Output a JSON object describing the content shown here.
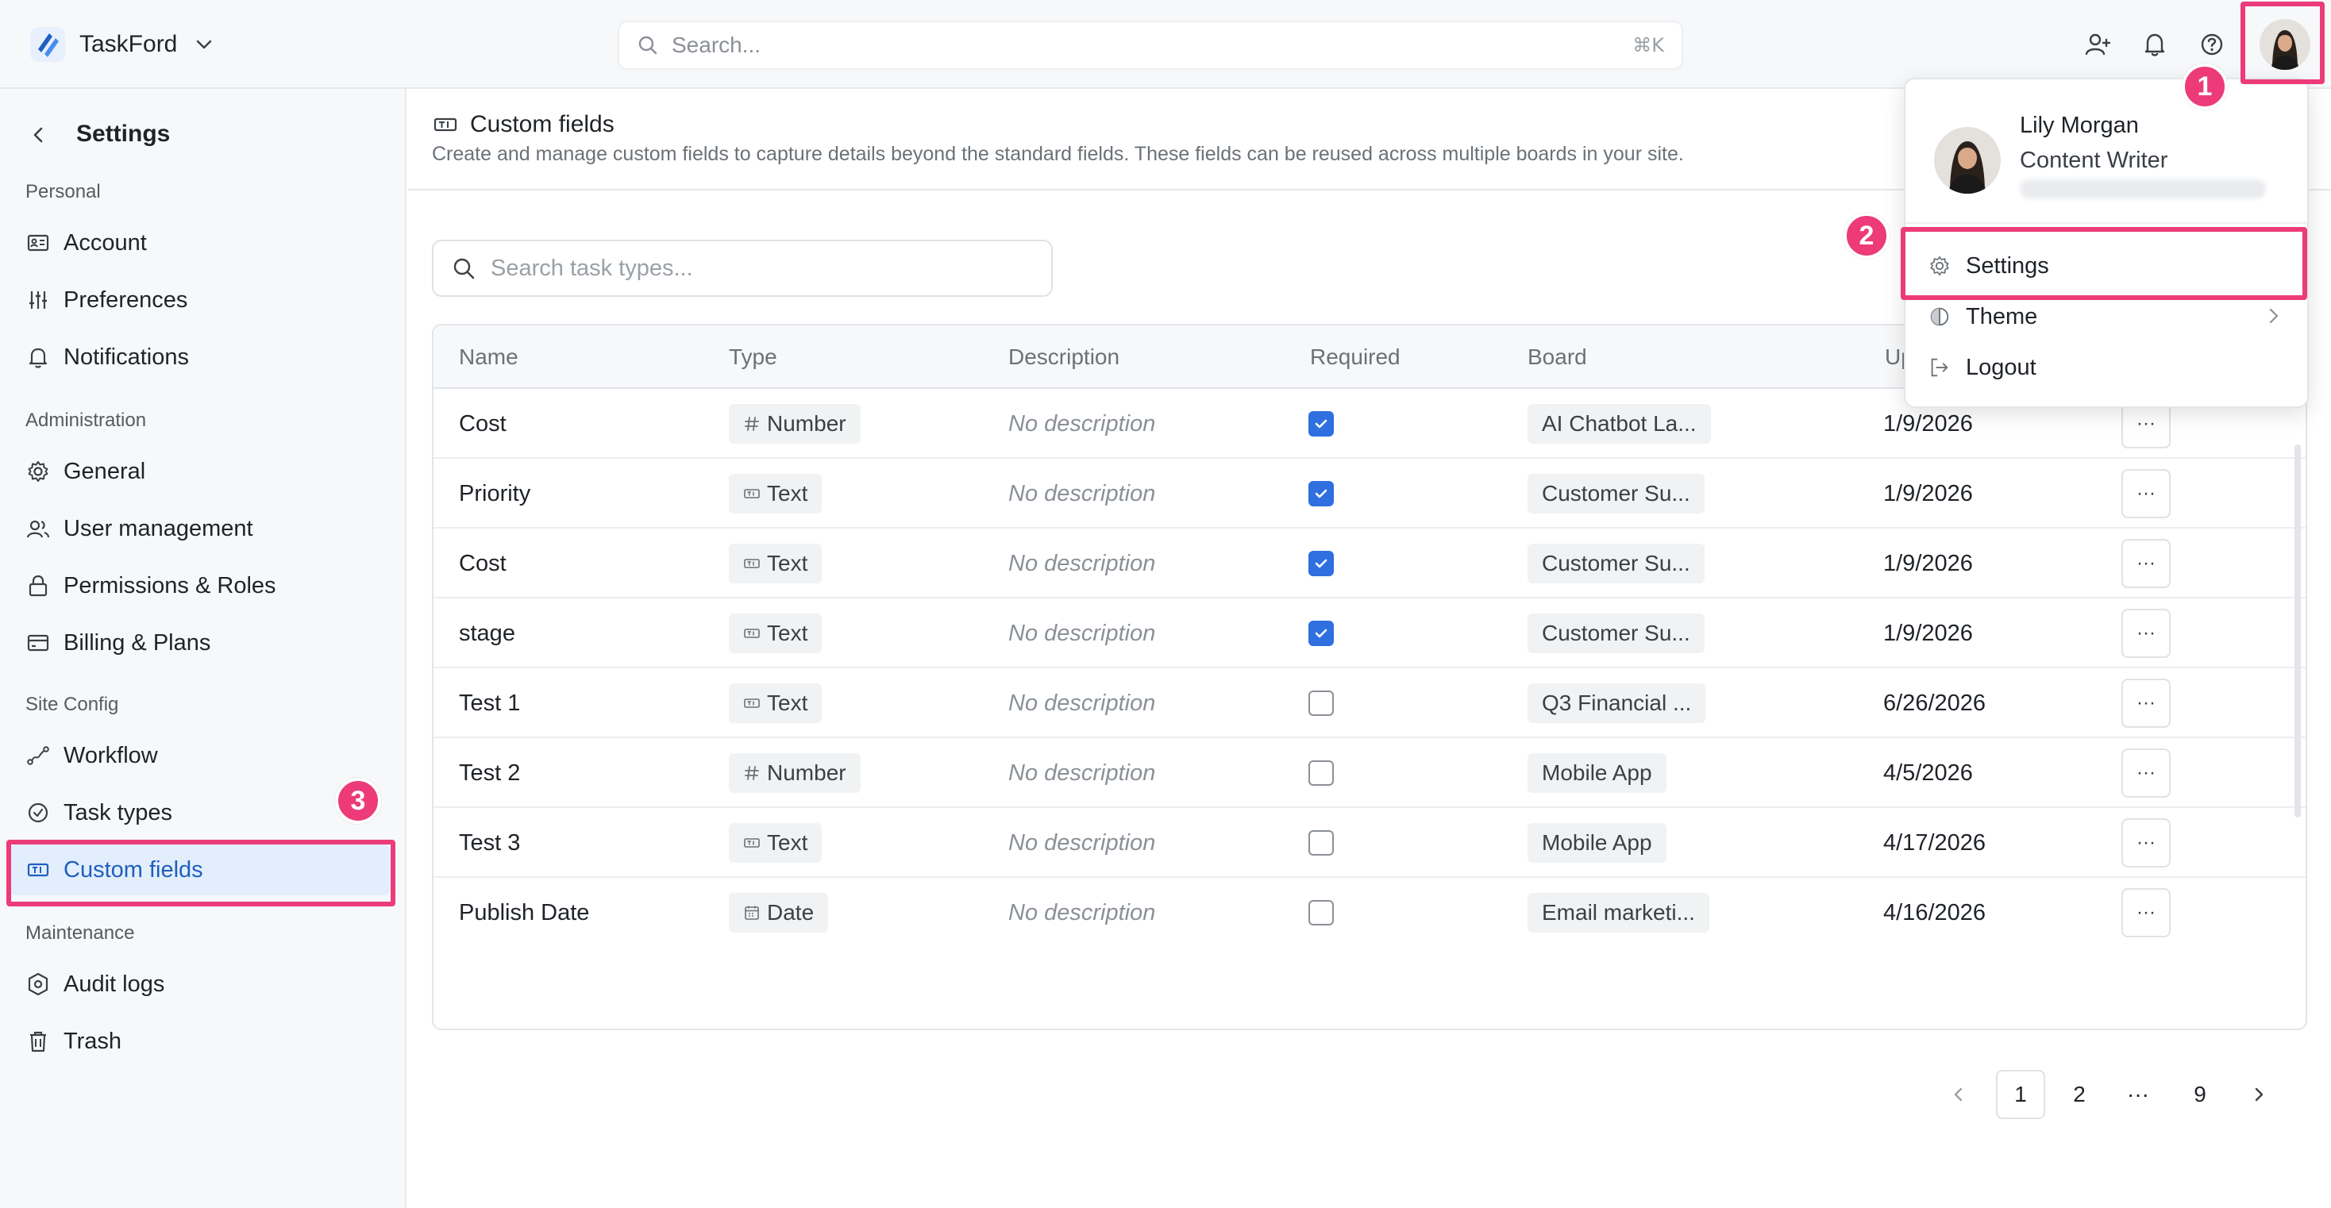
{
  "app": {
    "name": "TaskFord"
  },
  "search": {
    "placeholder": "Search...",
    "shortcut": "⌘K"
  },
  "sidebar": {
    "title": "Settings",
    "sections": [
      {
        "label": "Personal",
        "items": [
          {
            "label": "Account"
          },
          {
            "label": "Preferences"
          },
          {
            "label": "Notifications"
          }
        ]
      },
      {
        "label": "Administration",
        "items": [
          {
            "label": "General"
          },
          {
            "label": "User management"
          },
          {
            "label": "Permissions & Roles"
          },
          {
            "label": "Billing & Plans"
          }
        ]
      },
      {
        "label": "Site Config",
        "items": [
          {
            "label": "Workflow"
          },
          {
            "label": "Task types"
          },
          {
            "label": "Custom fields"
          }
        ]
      },
      {
        "label": "Maintenance",
        "items": [
          {
            "label": "Audit logs"
          },
          {
            "label": "Trash"
          }
        ]
      }
    ]
  },
  "page": {
    "title": "Custom fields",
    "description": "Create and manage custom fields to capture details beyond the standard fields. These fields can be reused across multiple boards in your site.",
    "search_placeholder": "Search task types..."
  },
  "table": {
    "columns": [
      "Name",
      "Type",
      "Description",
      "Required",
      "Board",
      "Up"
    ],
    "rows": [
      {
        "name": "Cost",
        "type": "Number",
        "type_icon": "hash-icon",
        "description": "No description",
        "required": true,
        "board": "AI Chatbot La...",
        "updated": "1/9/2026"
      },
      {
        "name": "Priority",
        "type": "Text",
        "type_icon": "text-field-icon",
        "description": "No description",
        "required": true,
        "board": "Customer Su...",
        "updated": "1/9/2026"
      },
      {
        "name": "Cost",
        "type": "Text",
        "type_icon": "text-field-icon",
        "description": "No description",
        "required": true,
        "board": "Customer Su...",
        "updated": "1/9/2026"
      },
      {
        "name": "stage",
        "type": "Text",
        "type_icon": "text-field-icon",
        "description": "No description",
        "required": true,
        "board": "Customer Su...",
        "updated": "1/9/2026"
      },
      {
        "name": "Test 1",
        "type": "Text",
        "type_icon": "text-field-icon",
        "description": "No description",
        "required": false,
        "board": "Q3 Financial ...",
        "updated": "6/26/2026"
      },
      {
        "name": "Test 2",
        "type": "Number",
        "type_icon": "hash-icon",
        "description": "No description",
        "required": false,
        "board": "Mobile App",
        "updated": "4/5/2026"
      },
      {
        "name": "Test 3",
        "type": "Text",
        "type_icon": "text-field-icon",
        "description": "No description",
        "required": false,
        "board": "Mobile App",
        "updated": "4/17/2026"
      },
      {
        "name": "Publish Date",
        "type": "Date",
        "type_icon": "calendar-icon",
        "description": "No description",
        "required": false,
        "board": "Email marketi...",
        "updated": "4/16/2026"
      }
    ],
    "row_action": "···"
  },
  "pagination": {
    "pages": [
      "1",
      "2",
      "···",
      "9"
    ],
    "current": "1"
  },
  "user_menu": {
    "name": "Lily Morgan",
    "role": "Content Writer",
    "items": [
      {
        "label": "Settings"
      },
      {
        "label": "Theme"
      },
      {
        "label": "Logout"
      }
    ]
  },
  "annotations": [
    "1",
    "2",
    "3"
  ],
  "colors": {
    "accent": "#2f6fe0",
    "highlight": "#ec3b78",
    "active_bg": "#e3eefc"
  }
}
